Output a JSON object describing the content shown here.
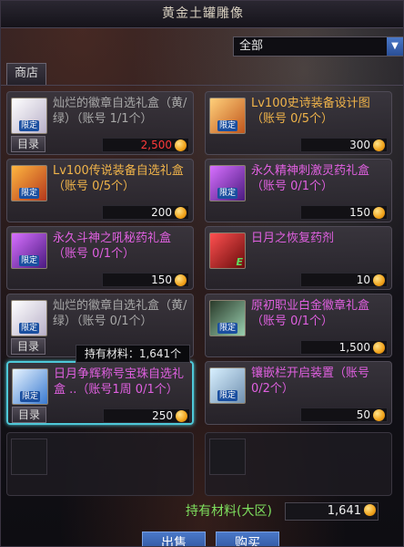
{
  "window": {
    "title": "黄金土罐雕像"
  },
  "filter": {
    "selected": "全部"
  },
  "tabs": {
    "shop": "商店"
  },
  "common": {
    "catalog_label": "目录",
    "badge_label": "限定"
  },
  "colors": {
    "orange": "#f0b44a",
    "magenta": "#e060e0",
    "white": "#f2f2f2",
    "red": "#ff3a3a",
    "cyan": "#4ec8d8",
    "green": "#7ee05e"
  },
  "items": [
    {
      "name": "灿烂的徽章自选礼盒（黄/绿）（账号 1/1个）",
      "price": "2,500",
      "color": "#a8a8a8",
      "price_color": "#ff3a3a",
      "icon": "white-box-icon",
      "has_catalog": true
    },
    {
      "name": "Lv100史诗装备设计图（账号 0/5个）",
      "price": "300",
      "color": "#f0b44a",
      "price_color": "#f2f2f2",
      "icon": "orange-scroll-icon",
      "has_catalog": false
    },
    {
      "name": "Lv100传说装备自选礼盒（账号 0/5个）",
      "price": "200",
      "color": "#f0b44a",
      "price_color": "#f2f2f2",
      "icon": "orange-box-icon",
      "has_catalog": false
    },
    {
      "name": "永久精神刺激灵药礼盒（账号 0/1个）",
      "price": "150",
      "color": "#e060e0",
      "price_color": "#f2f2f2",
      "icon": "purple-potion-icon",
      "has_catalog": false
    },
    {
      "name": "永久斗神之吼秘药礼盒（账号 0/1个）",
      "price": "150",
      "color": "#e060e0",
      "price_color": "#f2f2f2",
      "icon": "purple-potion-icon",
      "has_catalog": false
    },
    {
      "name": "日月之恢复药剂",
      "price": "10",
      "color": "#e060e0",
      "price_color": "#f2f2f2",
      "icon": "red-potion-icon",
      "has_catalog": false
    },
    {
      "name": "灿烂的徽章自选礼盒（黄/绿）（账号 0/1个）",
      "price": "",
      "color": "#a8a8a8",
      "price_color": "#f2f2f2",
      "icon": "white-box-icon",
      "has_catalog": true
    },
    {
      "name": "原初职业白金徽章礼盒（账号 0/1个）",
      "price": "1,500",
      "color": "#e060e0",
      "price_color": "#f2f2f2",
      "icon": "platinum-box-icon",
      "has_catalog": false
    },
    {
      "name": "日月争辉称号宝珠自选礼盒 ..（账号1周 0/1个）",
      "price": "250",
      "color": "#e060e0",
      "price_color": "#f2f2f2",
      "icon": "blue-orb-icon",
      "has_catalog": true,
      "selected": true
    },
    {
      "name": "镶嵌栏开启装置（账号 0/2个）",
      "price": "50",
      "color": "#e060e0",
      "price_color": "#f2f2f2",
      "icon": "socket-device-icon",
      "has_catalog": false
    }
  ],
  "tooltip": {
    "text": "持有材料：1,641个"
  },
  "bottom": {
    "material_label": "持有材料(大区)",
    "material_value": "1,641",
    "sell_label": "出售",
    "buy_label": "购买"
  }
}
